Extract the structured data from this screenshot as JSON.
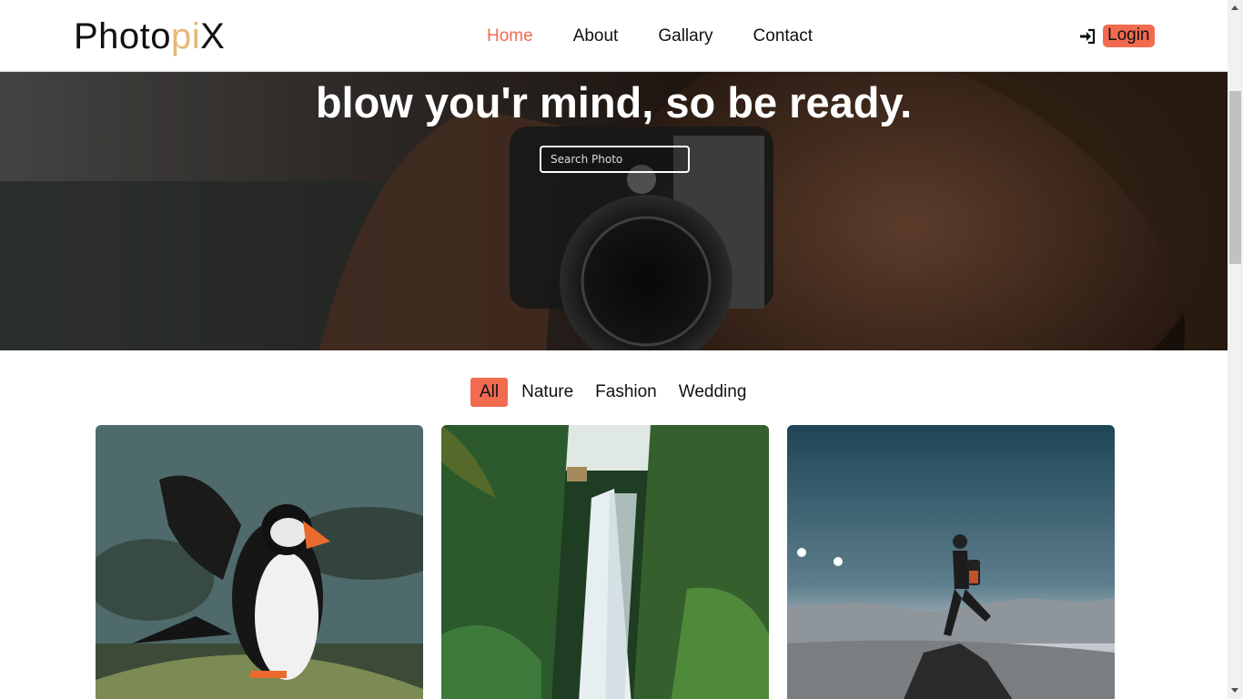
{
  "brand": {
    "prefix": "Photo",
    "accent": "pi",
    "suffix": "X"
  },
  "nav": {
    "items": [
      {
        "label": "Home",
        "active": true
      },
      {
        "label": "About"
      },
      {
        "label": "Gallary"
      },
      {
        "label": "Contact"
      }
    ],
    "login_label": "Login",
    "login_icon": "login-arrow-icon"
  },
  "hero": {
    "title": "blow you'r mind, so be ready.",
    "search_placeholder": "Search Photo"
  },
  "filters": [
    {
      "label": "All",
      "active": true
    },
    {
      "label": "Nature"
    },
    {
      "label": "Fashion"
    },
    {
      "label": "Wedding"
    }
  ],
  "colors": {
    "accent": "#f26b4f",
    "logo_accent": "#e6b87a"
  }
}
